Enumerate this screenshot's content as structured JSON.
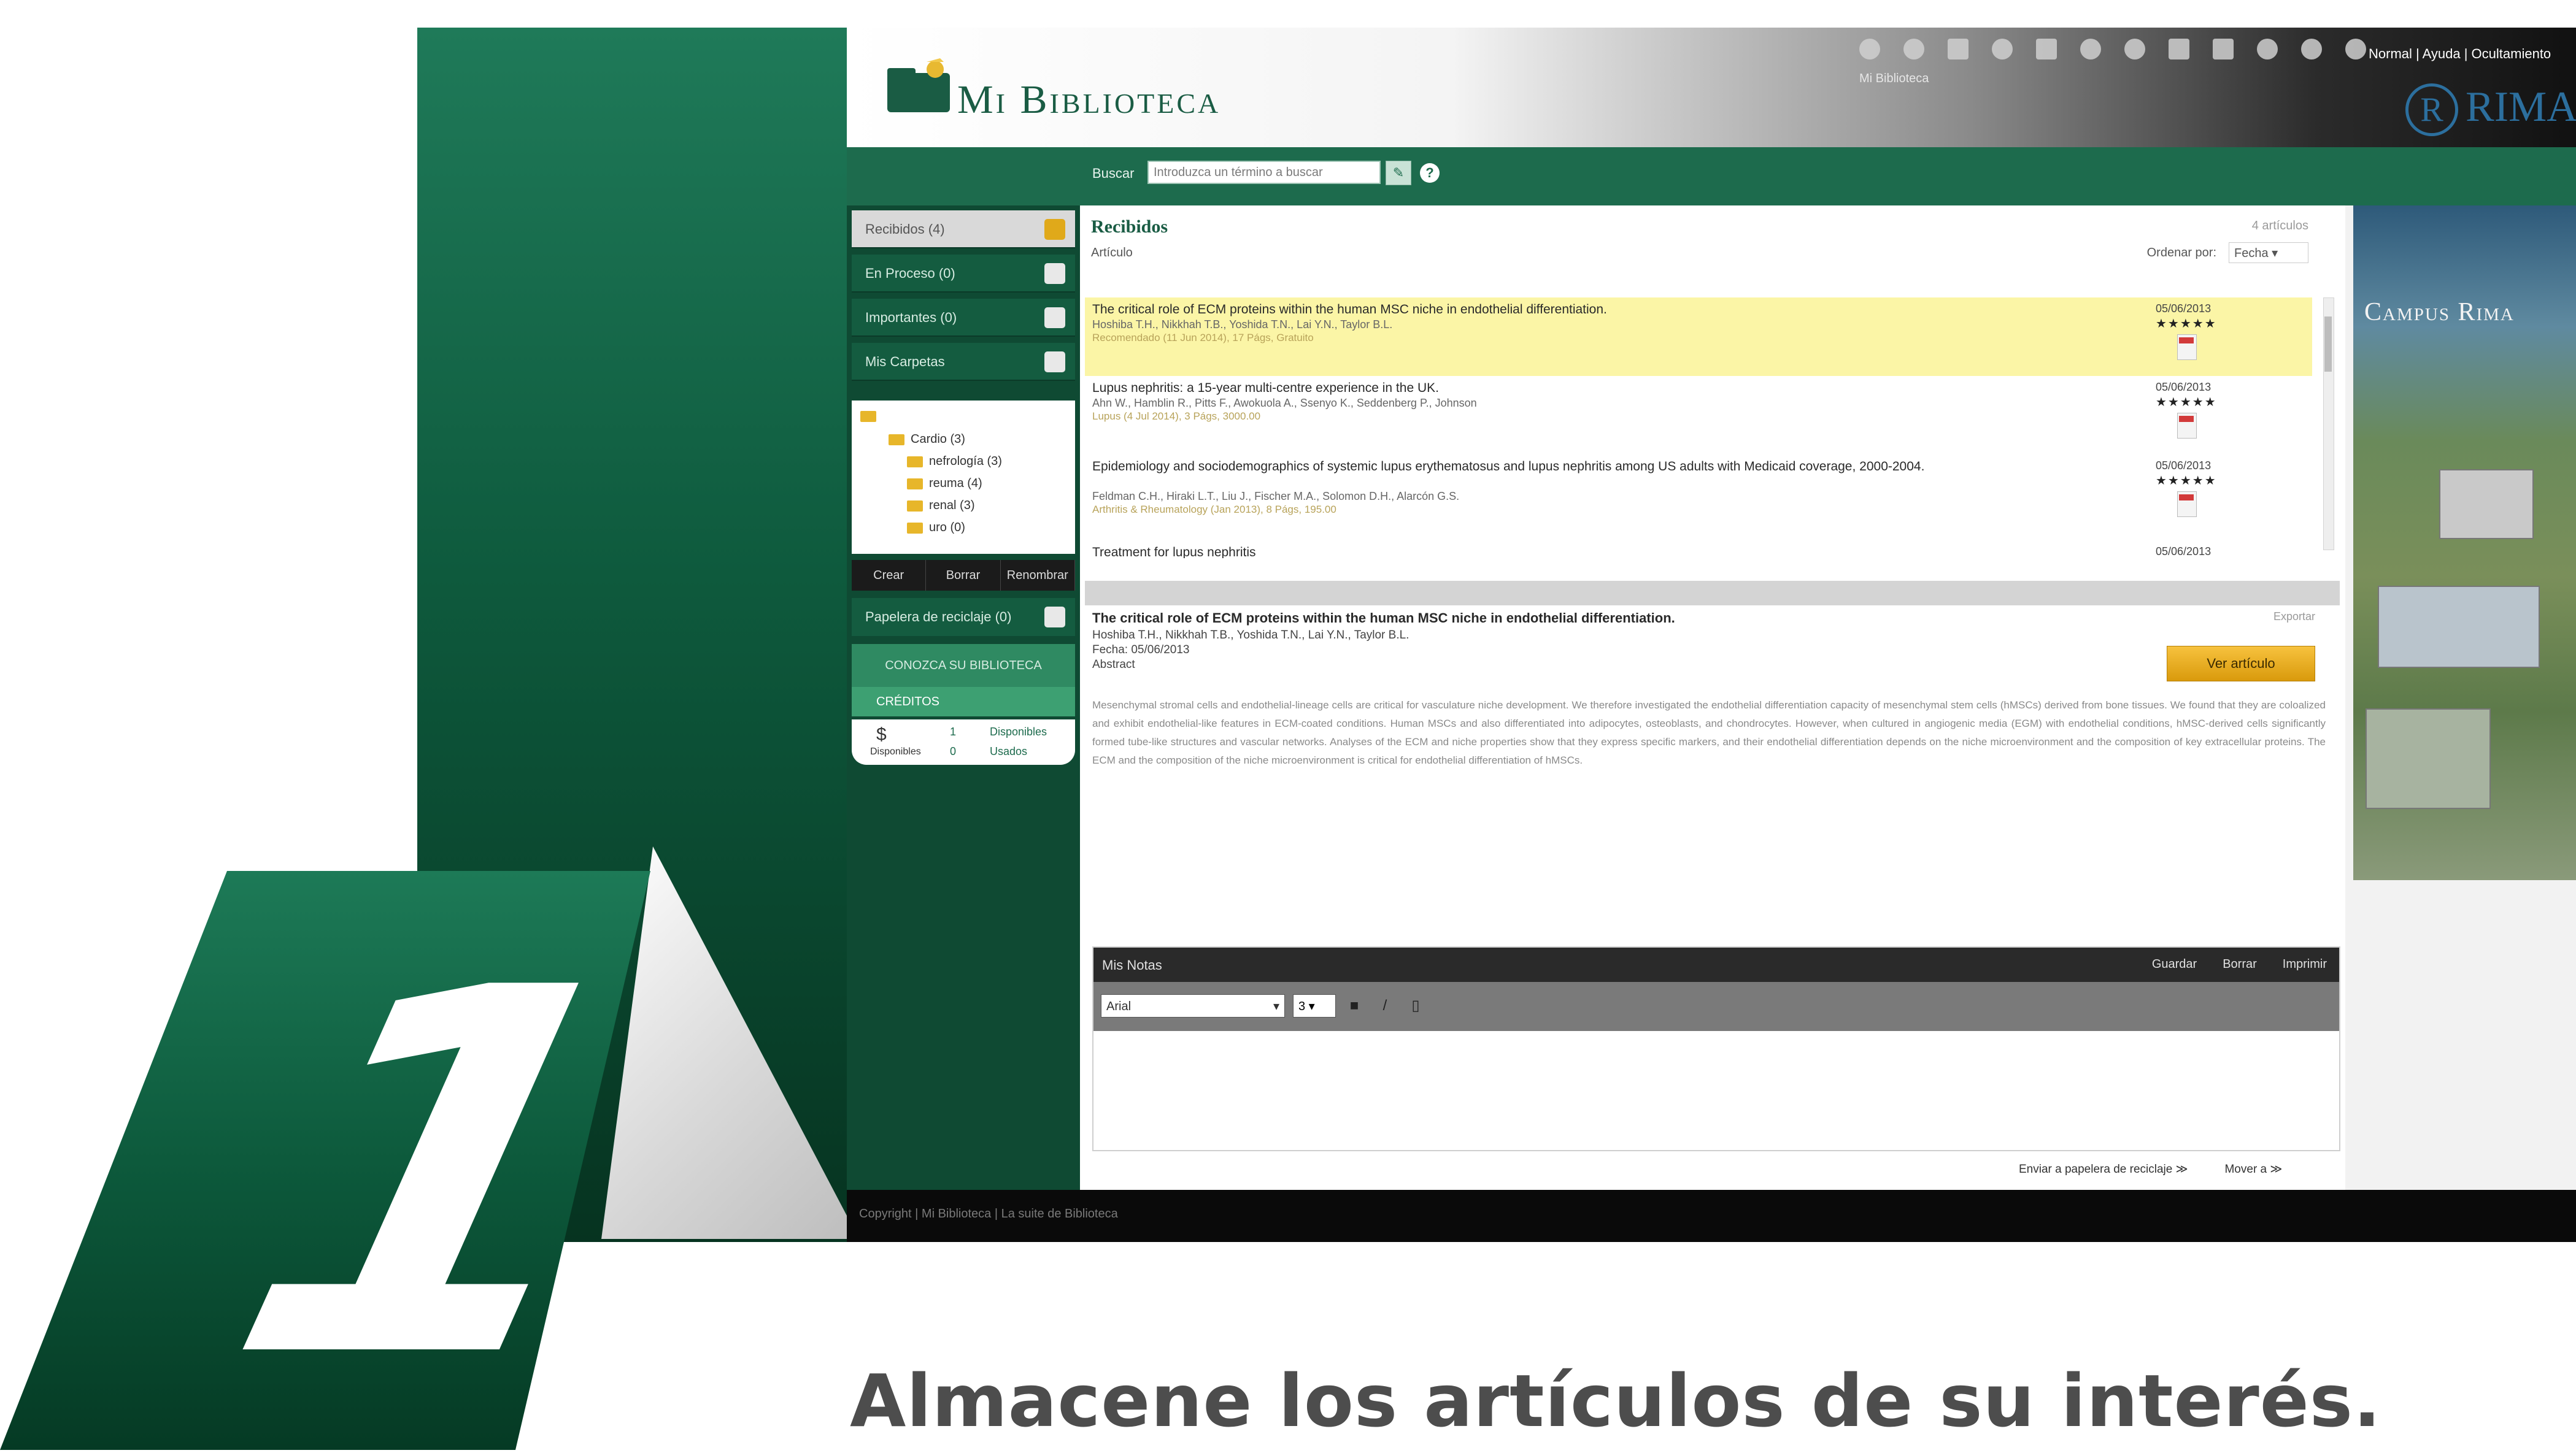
{
  "promo": {
    "number": "1",
    "tagline": "Almacene los artículos de su interés."
  },
  "app": {
    "title": "Mi Biblioteca",
    "small_label": "Mi Biblioteca",
    "top_links": "Normal | Ayuda | Ocultamiento",
    "brand": "RIMA",
    "search": {
      "label": "Buscar",
      "value": "Introduzca un término a buscar",
      "button_icon": "pencil-icon",
      "help": "?"
    },
    "sidebar": {
      "items": [
        {
          "label": "Recibidos (4)",
          "icon": "inbox-icon"
        },
        {
          "label": "En Proceso (0)",
          "icon": "calendar-icon"
        },
        {
          "label": "Importantes (0)",
          "icon": "star-icon"
        },
        {
          "label": "Mis Carpetas",
          "icon": "folder-icon"
        }
      ],
      "tree": [
        {
          "label": "Cardio (3)"
        },
        {
          "label": "nefrología (3)"
        },
        {
          "label": "reuma (4)"
        },
        {
          "label": "renal (3)"
        },
        {
          "label": "uro (0)"
        }
      ],
      "tree_tabs": [
        "Crear",
        "Borrar",
        "Renombrar"
      ],
      "trash": "Papelera de reciclaje (0)",
      "about": "CONOZCA SU BIBLIOTECA",
      "credits": "CRÉDITOS",
      "credit_box": {
        "available": "Disponibles",
        "available_value": "1",
        "used": "Usados",
        "used_value": "0"
      }
    },
    "list": {
      "title": "Recibidos",
      "count": "4 artículos",
      "subhead": "Artículo",
      "sort_label": "Ordenar por:",
      "sort_value": "Fecha",
      "articles": [
        {
          "title": "The critical role of ECM proteins within the human MSC niche in endothelial differentiation.",
          "authors": "Hoshiba T.H., Nikkhah T.B., Yoshida T.N., Lai Y.N., Taylor B.L.",
          "meta": "Recomendado (11 Jun 2014), 17 Págs, Gratuito",
          "date": "05/06/2013",
          "stars": "★★★★★"
        },
        {
          "title": "Lupus nephritis: a 15-year multi-centre experience in the UK.",
          "authors": "Ahn W., Hamblin R., Pitts F., Awokuola A., Ssenyo K., Seddenberg P., Johnson",
          "meta": "Lupus (4 Jul 2014), 3 Págs, 3000.00",
          "date": "05/06/2013",
          "stars": "★★★★★"
        },
        {
          "title": "Epidemiology and sociodemographics of systemic lupus erythematosus and lupus nephritis among US adults with Medicaid coverage, 2000-2004.",
          "authors": "Feldman C.H., Hiraki L.T., Liu J., Fischer M.A., Solomon D.H., Alarcón G.S.",
          "meta": "Arthritis & Rheumatology (Jan 2013), 8 Págs, 195.00",
          "date": "05/06/2013",
          "stars": "★★★★★"
        },
        {
          "title": "Treatment for lupus nephritis",
          "authors": "",
          "meta": "",
          "date": "05/06/2013",
          "stars": ""
        }
      ]
    },
    "detail": {
      "title": "The critical role of ECM proteins within the human MSC niche in endothelial differentiation.",
      "authors": "Hoshiba T.H., Nikkhah T.B., Yoshida T.N., Lai Y.N., Taylor B.L.",
      "date": "Fecha: 05/06/2013",
      "abstract_label": "Abstract",
      "export": "Exportar",
      "view_button": "Ver artículo",
      "abstract": "Mesenchymal stromal cells and endothelial-lineage cells are critical for vasculature niche development. We therefore investigated the endothelial differentiation capacity of mesenchymal stem cells (hMSCs) derived from bone tissues. We found that they are coloalized and exhibit endothelial-like features in ECM-coated conditions. Human MSCs and also differentiated into adipocytes, osteoblasts, and chondrocytes. However, when cultured in angiogenic media (EGM) with endothelial conditions, hMSC-derived cells significantly formed tube-like structures and vascular networks. Analyses of the ECM and niche properties show that they express specific markers, and their endothelial differentiation depends on the niche microenvironment and the composition of key extracellular proteins. The ECM and the composition of the niche microenvironment is critical for endothelial differentiation of hMSCs.",
      "notes": {
        "title": "Mis Notas",
        "actions": [
          "Guardar",
          "Borrar",
          "Imprimir"
        ],
        "font": "Arial",
        "size": "3",
        "tools": [
          "bold-icon",
          "italic-icon",
          "trash-icon"
        ]
      }
    },
    "bottom_actions": [
      "Enviar a papelera de reciclaje ≫",
      "Mover a ≫"
    ],
    "status": "Copyright | Mi Biblioteca | La suite de Biblioteca",
    "campus_title": "Campus Rima",
    "colors": {
      "primary": "#1d6b4d",
      "dark": "#0f4a33",
      "accent": "#e0a91a",
      "highlight": "#fbf5a6"
    }
  }
}
